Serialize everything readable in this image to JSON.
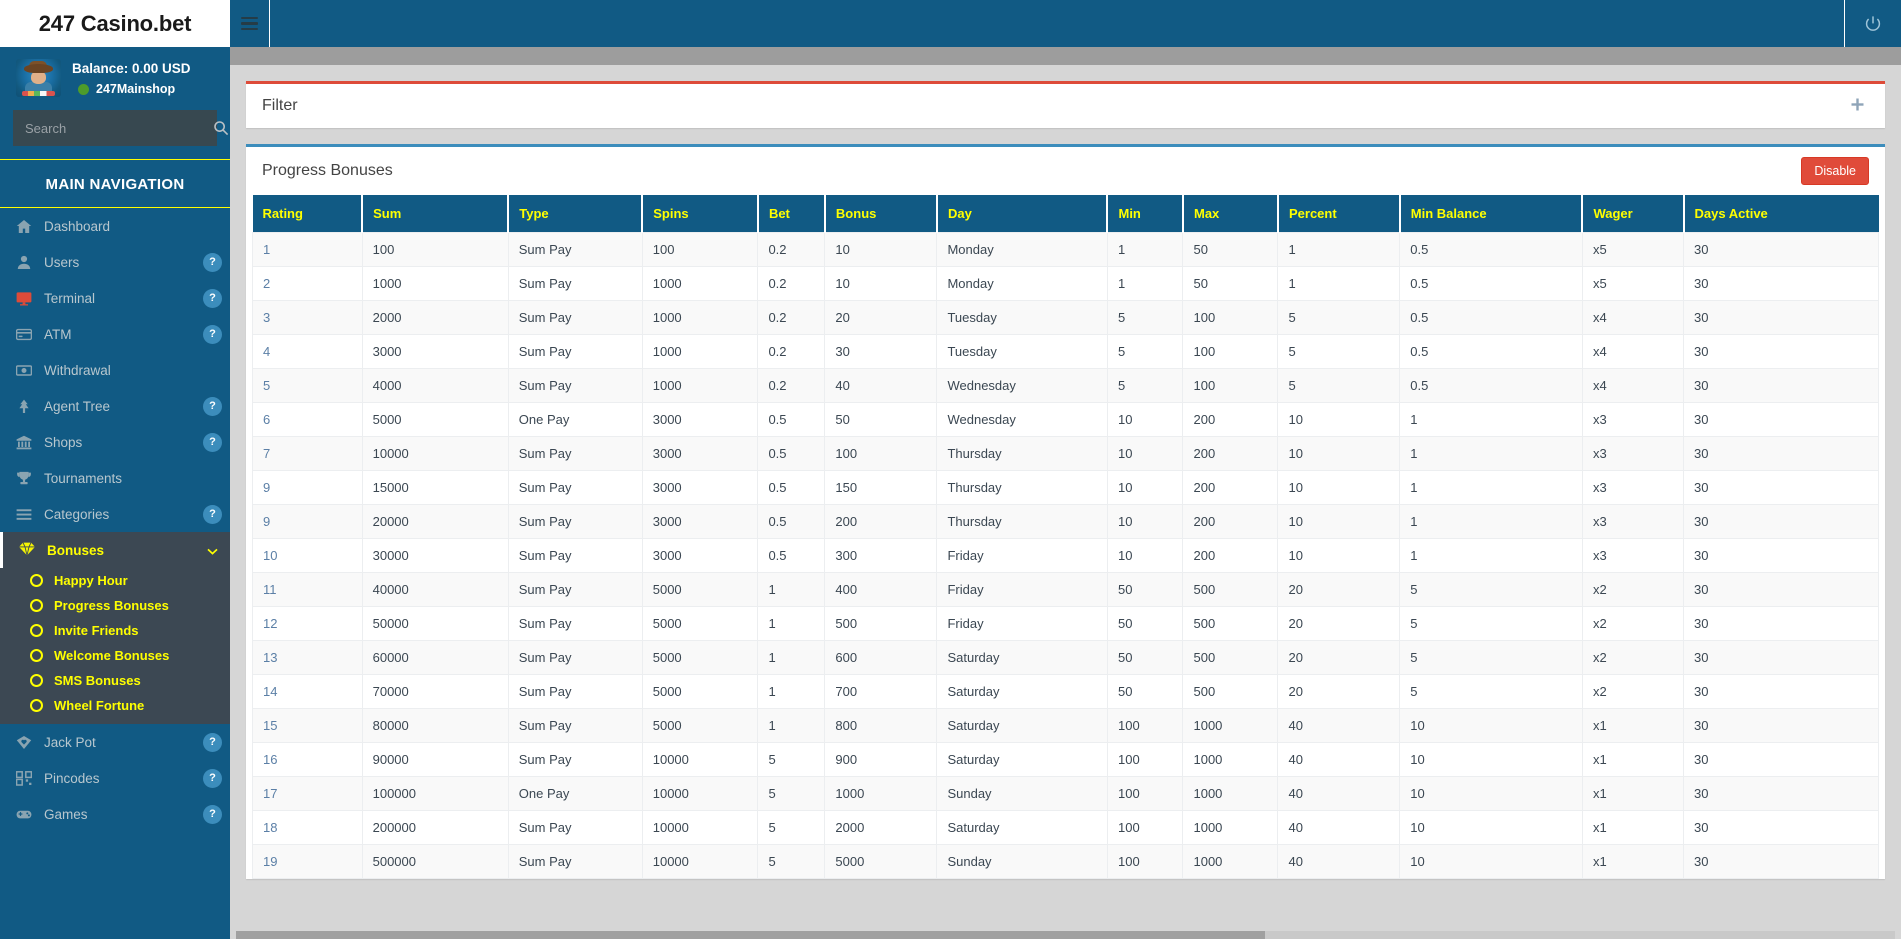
{
  "brand": {
    "name": "247 Casino.bet"
  },
  "user": {
    "balance_label": "Balance: 0.00 USD",
    "shop_name": "247Mainshop",
    "status_color": "#4d9c2b"
  },
  "search": {
    "placeholder": "Search",
    "value": "",
    "icon": "search-icon"
  },
  "sidebar": {
    "header": "MAIN NAVIGATION",
    "items": [
      {
        "label": "Dashboard",
        "icon": "home-icon",
        "badge": null
      },
      {
        "label": "Users",
        "icon": "user-icon",
        "badge": "?"
      },
      {
        "label": "Terminal",
        "icon": "monitor-icon",
        "badge": "?"
      },
      {
        "label": "ATM",
        "icon": "card-icon",
        "badge": "?"
      },
      {
        "label": "Withdrawal",
        "icon": "money-icon",
        "badge": null
      },
      {
        "label": "Agent Tree",
        "icon": "tree-icon",
        "badge": "?"
      },
      {
        "label": "Shops",
        "icon": "bank-icon",
        "badge": "?"
      },
      {
        "label": "Tournaments",
        "icon": "trophy-icon",
        "badge": null
      },
      {
        "label": "Categories",
        "icon": "list-icon",
        "badge": "?"
      }
    ],
    "bonuses": {
      "label": "Bonuses",
      "icon": "gem-icon",
      "chevron": "chevron-down-icon",
      "children": [
        {
          "label": "Happy Hour"
        },
        {
          "label": "Progress Bonuses"
        },
        {
          "label": "Invite Friends"
        },
        {
          "label": "Welcome Bonuses"
        },
        {
          "label": "SMS Bonuses"
        },
        {
          "label": "Wheel Fortune"
        }
      ]
    },
    "items_after": [
      {
        "label": "Jack Pot",
        "icon": "diamond-heart-icon",
        "badge": "?"
      },
      {
        "label": "Pincodes",
        "icon": "qr-icon",
        "badge": "?"
      },
      {
        "label": "Games",
        "icon": "gamepad-icon",
        "badge": "?"
      }
    ]
  },
  "topbar": {
    "menu_toggle_icon": "hamburger-icon",
    "power_icon": "power-icon"
  },
  "filter": {
    "title": "Filter",
    "expand_icon": "plus-icon"
  },
  "panel": {
    "title": "Progress Bonuses",
    "disable_label": "Disable",
    "accent_color": "#3c8dbc",
    "disable_color": "#e04b3a"
  },
  "table": {
    "columns": [
      "Rating",
      "Sum",
      "Type",
      "Spins",
      "Bet",
      "Bonus",
      "Day",
      "Min",
      "Max",
      "Percent",
      "Min Balance",
      "Wager",
      "Days Active"
    ],
    "rows": [
      [
        "1",
        "100",
        "Sum Pay",
        "100",
        "0.2",
        "10",
        "Monday",
        "1",
        "50",
        "1",
        "0.5",
        "x5",
        "30"
      ],
      [
        "2",
        "1000",
        "Sum Pay",
        "1000",
        "0.2",
        "10",
        "Monday",
        "1",
        "50",
        "1",
        "0.5",
        "x5",
        "30"
      ],
      [
        "3",
        "2000",
        "Sum Pay",
        "1000",
        "0.2",
        "20",
        "Tuesday",
        "5",
        "100",
        "5",
        "0.5",
        "x4",
        "30"
      ],
      [
        "4",
        "3000",
        "Sum Pay",
        "1000",
        "0.2",
        "30",
        "Tuesday",
        "5",
        "100",
        "5",
        "0.5",
        "x4",
        "30"
      ],
      [
        "5",
        "4000",
        "Sum Pay",
        "1000",
        "0.2",
        "40",
        "Wednesday",
        "5",
        "100",
        "5",
        "0.5",
        "x4",
        "30"
      ],
      [
        "6",
        "5000",
        "One Pay",
        "3000",
        "0.5",
        "50",
        "Wednesday",
        "10",
        "200",
        "10",
        "1",
        "x3",
        "30"
      ],
      [
        "7",
        "10000",
        "Sum Pay",
        "3000",
        "0.5",
        "100",
        "Thursday",
        "10",
        "200",
        "10",
        "1",
        "x3",
        "30"
      ],
      [
        "9",
        "15000",
        "Sum Pay",
        "3000",
        "0.5",
        "150",
        "Thursday",
        "10",
        "200",
        "10",
        "1",
        "x3",
        "30"
      ],
      [
        "9",
        "20000",
        "Sum Pay",
        "3000",
        "0.5",
        "200",
        "Thursday",
        "10",
        "200",
        "10",
        "1",
        "x3",
        "30"
      ],
      [
        "10",
        "30000",
        "Sum Pay",
        "3000",
        "0.5",
        "300",
        "Friday",
        "10",
        "200",
        "10",
        "1",
        "x3",
        "30"
      ],
      [
        "11",
        "40000",
        "Sum Pay",
        "5000",
        "1",
        "400",
        "Friday",
        "50",
        "500",
        "20",
        "5",
        "x2",
        "30"
      ],
      [
        "12",
        "50000",
        "Sum Pay",
        "5000",
        "1",
        "500",
        "Friday",
        "50",
        "500",
        "20",
        "5",
        "x2",
        "30"
      ],
      [
        "13",
        "60000",
        "Sum Pay",
        "5000",
        "1",
        "600",
        "Saturday",
        "50",
        "500",
        "20",
        "5",
        "x2",
        "30"
      ],
      [
        "14",
        "70000",
        "Sum Pay",
        "5000",
        "1",
        "700",
        "Saturday",
        "50",
        "500",
        "20",
        "5",
        "x2",
        "30"
      ],
      [
        "15",
        "80000",
        "Sum Pay",
        "5000",
        "1",
        "800",
        "Saturday",
        "100",
        "1000",
        "40",
        "10",
        "x1",
        "30"
      ],
      [
        "16",
        "90000",
        "Sum Pay",
        "10000",
        "5",
        "900",
        "Saturday",
        "100",
        "1000",
        "40",
        "10",
        "x1",
        "30"
      ],
      [
        "17",
        "100000",
        "One Pay",
        "10000",
        "5",
        "1000",
        "Sunday",
        "100",
        "1000",
        "40",
        "10",
        "x1",
        "30"
      ],
      [
        "18",
        "200000",
        "Sum Pay",
        "10000",
        "5",
        "2000",
        "Saturday",
        "100",
        "1000",
        "40",
        "10",
        "x1",
        "30"
      ],
      [
        "19",
        "500000",
        "Sum Pay",
        "10000",
        "5",
        "5000",
        "Sunday",
        "100",
        "1000",
        "40",
        "10",
        "x1",
        "30"
      ]
    ]
  }
}
